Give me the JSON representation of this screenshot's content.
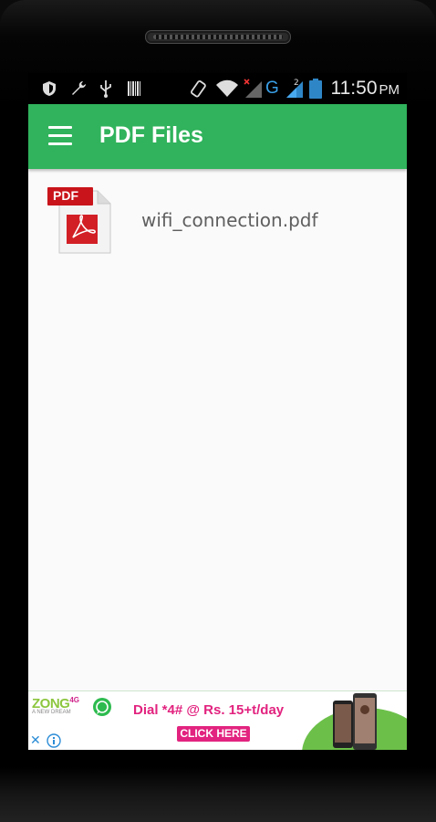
{
  "status_bar": {
    "time": "11:50",
    "ampm": "PM",
    "network_label": "G",
    "roaming_label": "2",
    "icons": [
      "shield-icon",
      "wrench-icon",
      "usb-icon",
      "barcode-icon",
      "rotate-icon",
      "wifi-icon",
      "signal-no-service-icon",
      "signal-icon",
      "battery-icon"
    ]
  },
  "app_bar": {
    "title": "PDF Files",
    "menu_icon": "hamburger-menu-icon"
  },
  "files": [
    {
      "name": "wifi_connection.pdf",
      "badge": "PDF",
      "icon": "pdf-file-icon"
    }
  ],
  "ad_banner": {
    "brand": "ZONG",
    "brand_suffix": "4G",
    "brand_tagline": "A NEW DREAM",
    "text": "Dial *4# @ Rs. 15+t/day",
    "button": "CLICK HERE",
    "close_symbol": "✕",
    "colors": {
      "brand_green": "#8cc63f",
      "accent_pink": "#e2237f"
    }
  },
  "colors": {
    "app_bar": "#30b35c",
    "screen_background": "#fafafa",
    "file_text": "#5f5f5f"
  }
}
